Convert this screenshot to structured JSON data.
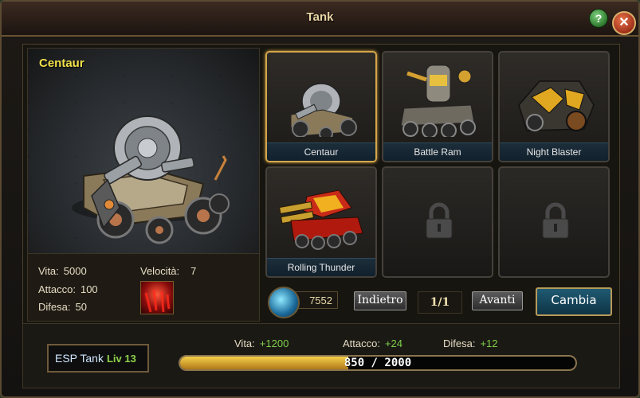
{
  "window": {
    "title": "Tank",
    "help_label": "?",
    "close_label": "✕"
  },
  "preview": {
    "name": "Centaur"
  },
  "stats": {
    "vita_label": "Vita:",
    "vita_value": "5000",
    "attacco_label": "Attacco:",
    "attacco_value": "100",
    "difesa_label": "Difesa:",
    "difesa_value": "50",
    "velocita_label": "Velocità:",
    "velocita_value": "7"
  },
  "slots": [
    {
      "label": "Centaur",
      "selected": true,
      "locked": false
    },
    {
      "label": "Battle Ram",
      "selected": false,
      "locked": false
    },
    {
      "label": "Night Blaster",
      "selected": false,
      "locked": false
    },
    {
      "label": "Rolling Thunder",
      "selected": false,
      "locked": false
    },
    {
      "label": "",
      "selected": false,
      "locked": true
    },
    {
      "label": "",
      "selected": false,
      "locked": true
    }
  ],
  "controls": {
    "crystals": "7552",
    "back_label": "Indietro",
    "page": "1/1",
    "next_label": "Avanti",
    "change_label": "Cambia"
  },
  "esp": {
    "name": "ESP Tank",
    "level": "Liv 13"
  },
  "bonus": {
    "vita_label": "Vita:",
    "vita_value": "+1200",
    "attacco_label": "Attacco:",
    "attacco_value": "+24",
    "difesa_label": "Difesa:",
    "difesa_value": "+12"
  },
  "xp": {
    "text": "850 / 2000",
    "current": 850,
    "max": 2000
  },
  "icons": [
    "help-icon",
    "close-icon",
    "lock-icon",
    "crystal-icon",
    "skill-icon"
  ]
}
